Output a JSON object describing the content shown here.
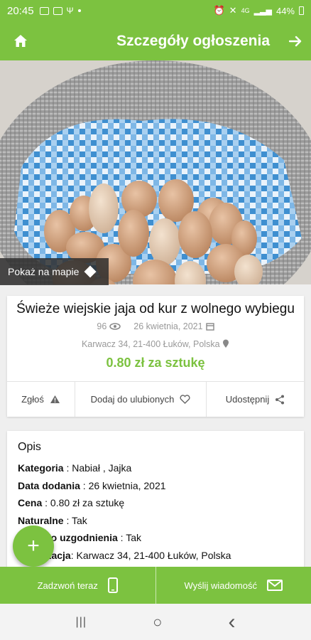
{
  "status_bar": {
    "time": "20:45",
    "battery": "44%",
    "left_icons": [
      "image-icon",
      "facebook-icon",
      "signal-icon",
      "dot-icon"
    ],
    "right_icons": [
      "alarm-icon",
      "mute-icon",
      "4g-icon",
      "signal-icon",
      "battery-icon"
    ]
  },
  "app_bar": {
    "title": "Szczegóły ogłoszenia",
    "home_icon": "home-icon",
    "next_icon": "arrow-right-icon"
  },
  "photo": {
    "map_button_label": "Pokaż na mapie"
  },
  "listing": {
    "title": "Świeże wiejskie jaja od kur z wolnego wybiegu",
    "views": "96",
    "date": "26 kwietnia, 2021",
    "location": "Karwacz 34, 21-400 Łuków, Polska",
    "price": "0.80 zł za sztukę"
  },
  "actions": {
    "report_label": "Zgłoś",
    "favorite_label": "Dodaj do ulubionych",
    "share_label": "Udostępnij"
  },
  "description": {
    "heading": "Opis",
    "rows": [
      {
        "key": "Kategoria",
        "value": " : Nabiał , Jajka"
      },
      {
        "key": "Data dodania",
        "value": " : 26 kwietnia, 2021"
      },
      {
        "key": "Cena",
        "value": " : 0.80 zł za sztukę"
      },
      {
        "key": "Naturalne",
        "value": " : Tak"
      },
      {
        "key": "Cena do uzgodnienia",
        "value": " : Tak"
      },
      {
        "key": "Lokalizacja",
        "value": ": Karwacz 34, 21-400 Łuków, Polska"
      }
    ]
  },
  "fab": {
    "label": "+"
  },
  "bottom_bar": {
    "call_label": "Zadzwoń teraz",
    "message_label": "Wyślij wiadomość"
  },
  "nav_bar": {
    "recents": "|||",
    "home": "○",
    "back": "‹"
  },
  "colors": {
    "accent": "#7cc240",
    "text": "#111111",
    "muted": "#999999"
  }
}
